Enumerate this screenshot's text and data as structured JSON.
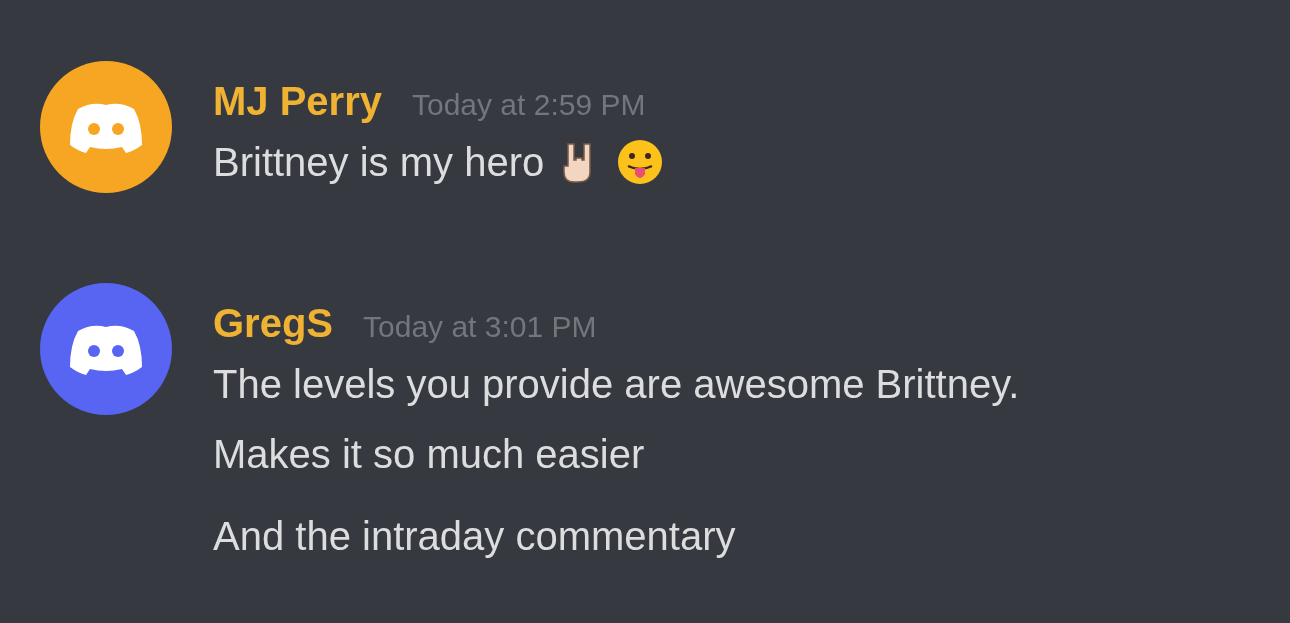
{
  "messages": [
    {
      "author": "MJ Perry",
      "timestamp": "Today at 2:59 PM",
      "color": "#f6a623",
      "lines": [
        [
          {
            "kind": "text",
            "text": "Brittney is my hero"
          },
          {
            "kind": "rock-hand"
          },
          {
            "kind": "tongue-face"
          }
        ]
      ]
    },
    {
      "author": "GregS",
      "timestamp": "Today at 3:01 PM",
      "color": "#5865f2",
      "lines": [
        [
          {
            "kind": "text",
            "text": "The levels you provide are awesome Brittney."
          }
        ],
        [
          {
            "kind": "text",
            "text": "Makes it so much easier"
          }
        ],
        [
          {
            "kind": "gap"
          },
          {
            "kind": "text",
            "text": "And the intraday commentary"
          }
        ]
      ]
    }
  ]
}
